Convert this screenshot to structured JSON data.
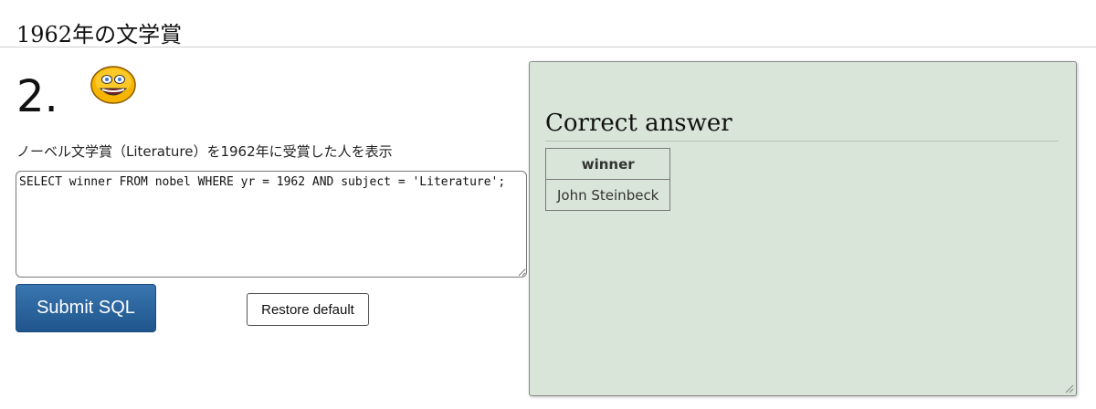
{
  "section": {
    "title": "1962年の文学賞"
  },
  "question": {
    "number": "2.",
    "text": "ノーベル文学賞（Literature）を1962年に受賞した人を表示",
    "sql": "SELECT winner FROM nobel WHERE yr = 1962 AND subject = 'Literature';"
  },
  "buttons": {
    "submit_label": "Submit SQL",
    "restore_label": "Restore default"
  },
  "answer": {
    "title": "Correct answer",
    "columns": [
      "winner"
    ],
    "rows": [
      [
        "John Steinbeck"
      ]
    ]
  },
  "icons": {
    "status": "smiley-icon"
  },
  "colors": {
    "submit_button": "#2a64a0",
    "answer_panel": "#d9e5d9"
  }
}
